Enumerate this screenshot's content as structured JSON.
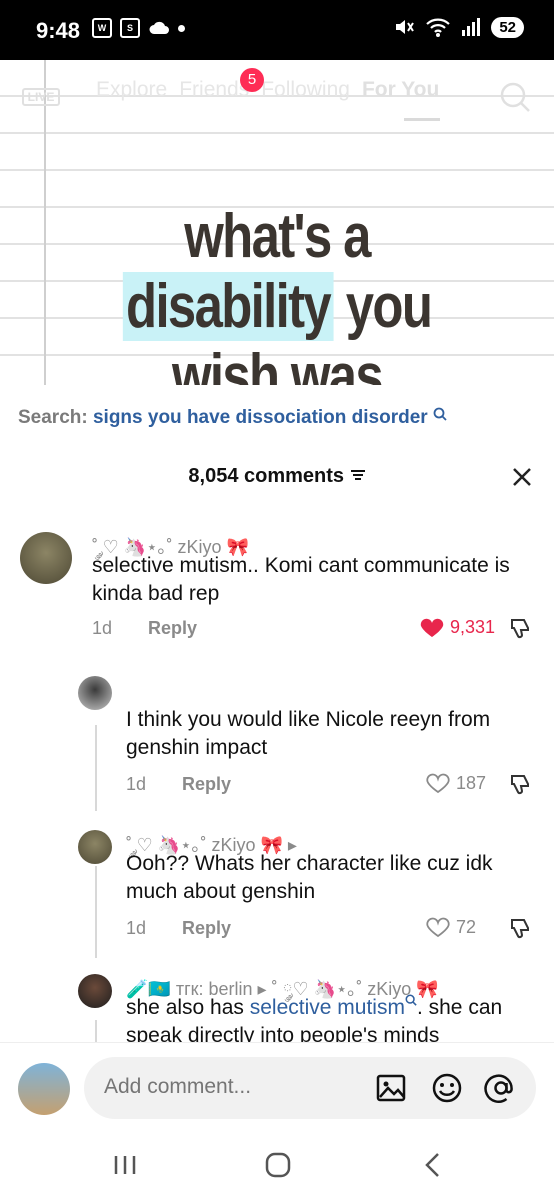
{
  "status_bar": {
    "time": "9:48",
    "battery": "52"
  },
  "top_nav": {
    "live_label": "LIVE",
    "tabs": [
      {
        "label": "Explore"
      },
      {
        "label": "Friends"
      },
      {
        "label": "Following"
      },
      {
        "label": "For You",
        "active": true
      }
    ],
    "friends_badge": "5"
  },
  "video": {
    "headline_line1": "what's a",
    "headline_highlight": "disability",
    "headline_line2_rest": " you",
    "headline_line3": "wish was"
  },
  "search": {
    "label": "Search:",
    "query": "signs you have dissociation disorder"
  },
  "comments_header": {
    "count_label": "8,054 comments"
  },
  "comments": [
    {
      "username": "˚ ༘♡ 🦄⋆｡˚ zKiyo 🎀",
      "text": "selective mutism.. Komi cant communicate is kinda bad rep",
      "age": "1d",
      "reply_label": "Reply",
      "likes": "9,331",
      "liked": true
    },
    {
      "username": "",
      "text": "I think you would like Nicole reeyn from genshin impact",
      "age": "1d",
      "reply_label": "Reply",
      "likes": "187",
      "liked": false
    },
    {
      "username": "˚ ༘♡ 🦄⋆｡˚ zKiyo 🎀 ▸",
      "text": "Ooh?? Whats her character like cuz idk much about genshin",
      "age": "1d",
      "reply_label": "Reply",
      "likes": "72",
      "liked": false
    },
    {
      "username": "🧪🇰🇿 тгк: berlin ▸ ˚ ༘♡ 🦄⋆｡˚ zKiyo 🎀",
      "text_before": "she also has ",
      "text_link": "selective mutism",
      "text_after": ". she can speak directly into people's minds"
    }
  ],
  "input": {
    "placeholder": "Add comment..."
  },
  "icons": {
    "search_top": "search-icon",
    "close": "close-icon",
    "filter": "filter-icon",
    "heart": "heart-icon",
    "dislike": "dislike-icon",
    "image": "image-icon",
    "emoji": "emoji-icon",
    "mention": "at-icon"
  },
  "colors": {
    "like_red": "#e8264c",
    "link_blue": "#2f5f9e",
    "badge_red": "#fe2c55"
  }
}
